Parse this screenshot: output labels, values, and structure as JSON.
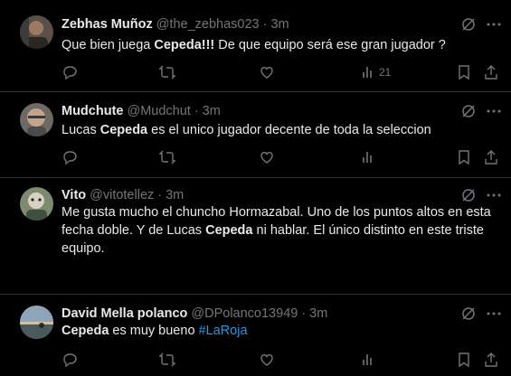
{
  "tweets": [
    {
      "name": "Zebhas Muñoz",
      "handle": "@the_zebhas023",
      "sep": "·",
      "time": "3m",
      "text": {
        "a": "Que bien juega ",
        "b": "Cepeda!!!",
        "c": " De que equipo será ese gran jugador ?"
      },
      "views": "21"
    },
    {
      "name": "Mudchute",
      "handle": "@Mudchut",
      "sep": "·",
      "time": "3m",
      "text": {
        "a": "Lucas ",
        "b": "Cepeda",
        "c": " es el unico jugador decente de toda la seleccion"
      },
      "views": ""
    },
    {
      "name": "Vito",
      "handle": "@vitotellez",
      "sep": "·",
      "time": "3m",
      "text": {
        "a": "Me gusta mucho el chuncho Hormazabal. Uno de los puntos altos en esta fecha doble. Y de Lucas ",
        "b": "Cepeda",
        "c": " ni hablar. El único distinto en este triste equipo."
      },
      "views": ""
    },
    {
      "name": "David Mella polanco",
      "handle": "@DPolanco13949",
      "sep": "·",
      "time": "3m",
      "text": {
        "a": "",
        "b": "Cepeda",
        "c": " es muy bueno"
      },
      "hashtag": "#LaRoja",
      "views": ""
    }
  ],
  "icons": {
    "grok": "grok-icon",
    "more": "more-icon",
    "reply": "reply-icon",
    "retweet": "retweet-icon",
    "like": "like-icon",
    "views": "views-icon",
    "bookmark": "bookmark-icon",
    "share": "share-icon"
  },
  "colors": {
    "background": "#000000",
    "text": "#e7e9ea",
    "muted": "#71767b",
    "divider": "#2f3336",
    "hashtag": "#1d9bf0"
  }
}
